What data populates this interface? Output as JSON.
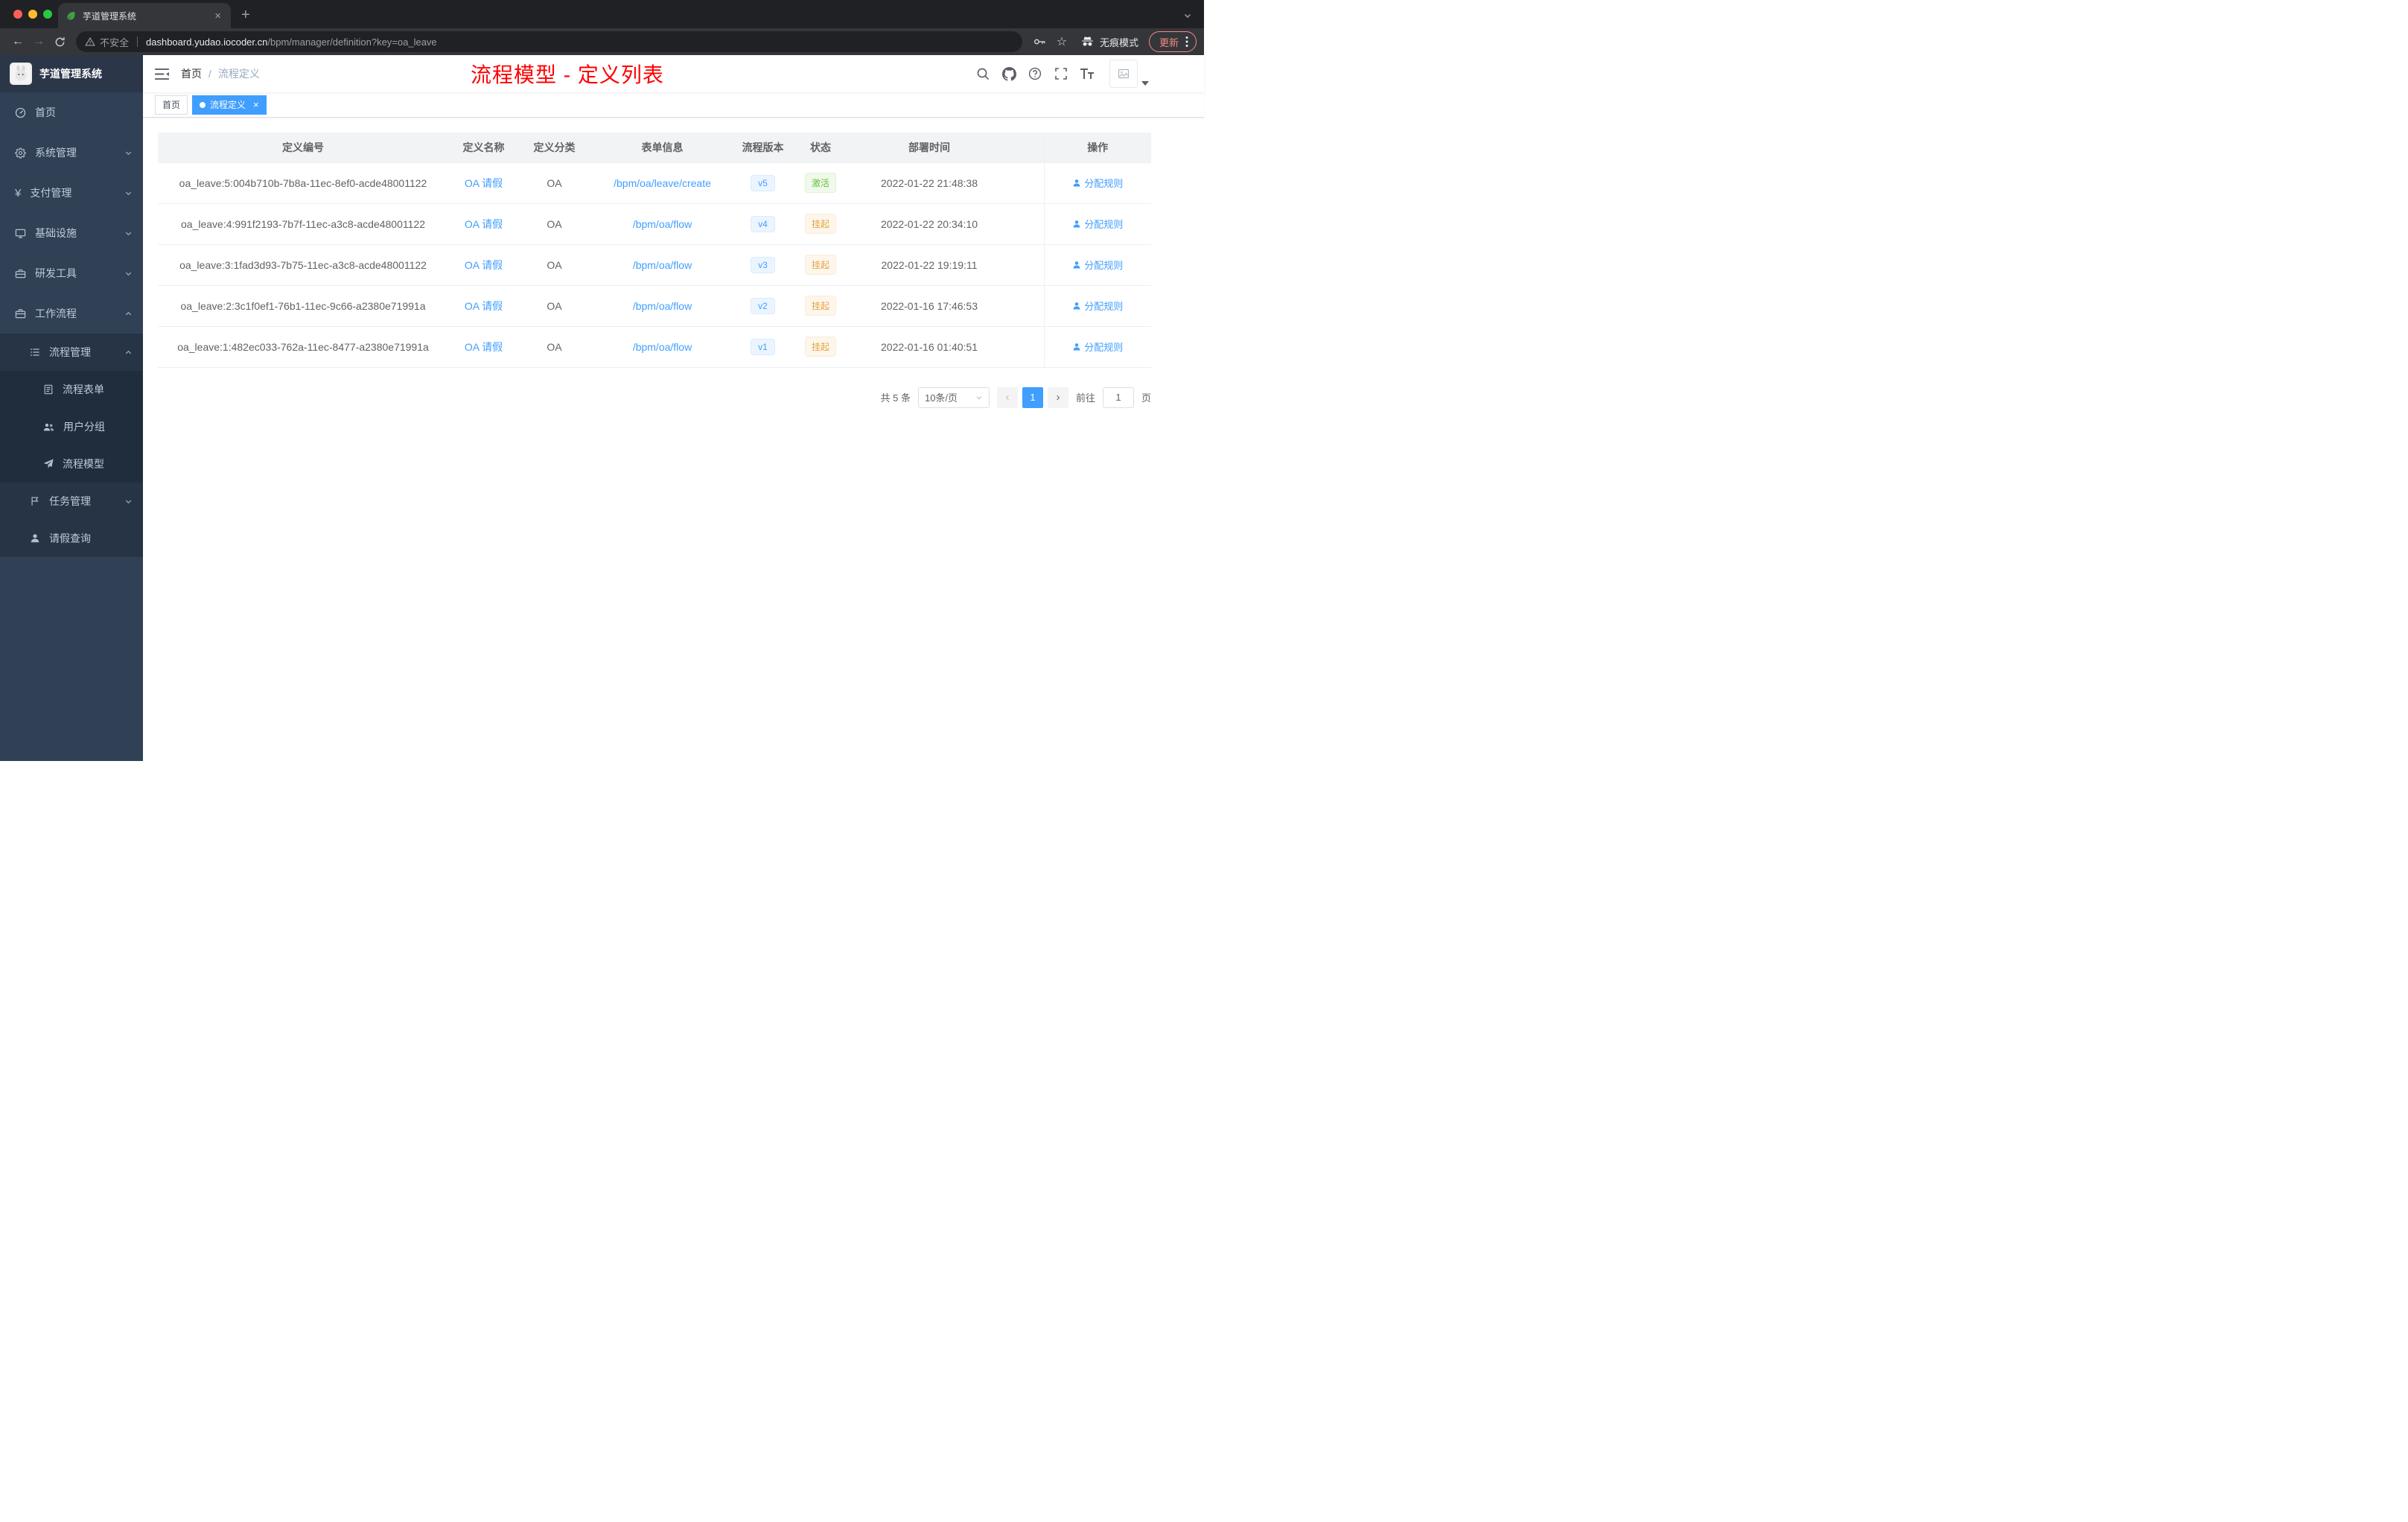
{
  "browser": {
    "tab": {
      "title": "芋道管理系统"
    },
    "toolbar": {
      "security_label": "不安全",
      "url_host": "dashboard.yudao.iocoder.cn",
      "url_path": "/bpm/manager/definition?key=oa_leave",
      "incognito_label": "无痕模式",
      "update_label": "更新"
    }
  },
  "glyphs": {
    "close": "×",
    "plus": "+",
    "back": "←",
    "forward": "→",
    "star": "☆",
    "yen": "¥",
    "prev": "‹",
    "next": "›"
  },
  "sidebar": {
    "logo_title": "芋道管理系统",
    "items": [
      {
        "label": "首页"
      },
      {
        "label": "系统管理"
      },
      {
        "label": "支付管理"
      },
      {
        "label": "基础设施"
      },
      {
        "label": "研发工具"
      },
      {
        "label": "工作流程"
      },
      {
        "label": "流程管理"
      },
      {
        "label": "流程表单"
      },
      {
        "label": "用户分组"
      },
      {
        "label": "流程模型"
      },
      {
        "label": "任务管理"
      },
      {
        "label": "请假查询"
      }
    ]
  },
  "header": {
    "breadcrumb_home": "首页",
    "breadcrumb_sep": "/",
    "breadcrumb_current": "流程定义",
    "annotation": "流程模型 - 定义列表"
  },
  "tags": {
    "home": "首页",
    "active": "流程定义"
  },
  "table": {
    "columns": [
      "定义编号",
      "定义名称",
      "定义分类",
      "表单信息",
      "流程版本",
      "状态",
      "部署时间",
      "操作"
    ],
    "rows": [
      {
        "id": "oa_leave:5:004b710b-7b8a-11ec-8ef0-acde48001122",
        "name": "OA 请假",
        "category": "OA",
        "form": "/bpm/oa/leave/create",
        "version": "v5",
        "status": "激活",
        "status_type": "success",
        "deploy_time": "2022-01-22 21:48:38",
        "action": "分配规则"
      },
      {
        "id": "oa_leave:4:991f2193-7b7f-11ec-a3c8-acde48001122",
        "name": "OA 请假",
        "category": "OA",
        "form": "/bpm/oa/flow",
        "version": "v4",
        "status": "挂起",
        "status_type": "warning",
        "deploy_time": "2022-01-22 20:34:10",
        "action": "分配规则"
      },
      {
        "id": "oa_leave:3:1fad3d93-7b75-11ec-a3c8-acde48001122",
        "name": "OA 请假",
        "category": "OA",
        "form": "/bpm/oa/flow",
        "version": "v3",
        "status": "挂起",
        "status_type": "warning",
        "deploy_time": "2022-01-22 19:19:11",
        "action": "分配规则"
      },
      {
        "id": "oa_leave:2:3c1f0ef1-76b1-11ec-9c66-a2380e71991a",
        "name": "OA 请假",
        "category": "OA",
        "form": "/bpm/oa/flow",
        "version": "v2",
        "status": "挂起",
        "status_type": "warning",
        "deploy_time": "2022-01-16 17:46:53",
        "action": "分配规则"
      },
      {
        "id": "oa_leave:1:482ec033-762a-11ec-8477-a2380e71991a",
        "name": "OA 请假",
        "category": "OA",
        "form": "/bpm/oa/flow",
        "version": "v1",
        "status": "挂起",
        "status_type": "warning",
        "deploy_time": "2022-01-16 01:40:51",
        "action": "分配规则"
      }
    ]
  },
  "pagination": {
    "total_label": "共 5 条",
    "page_size": "10条/页",
    "current_page": "1",
    "goto_label": "前往",
    "goto_value": "1",
    "page_suffix": "页"
  },
  "colors": {
    "accent": "#409eff",
    "success": "#67c23a",
    "warning": "#e6a23c",
    "annotation": "#ff0000"
  }
}
